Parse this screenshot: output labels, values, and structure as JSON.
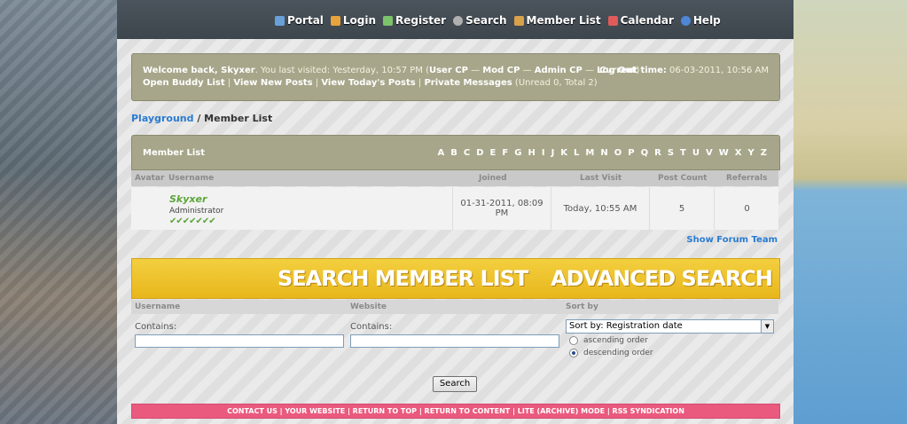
{
  "nav": {
    "items": [
      {
        "label": "Portal",
        "icon": "portal-icon",
        "color": "#6aa0d8"
      },
      {
        "label": "Login",
        "icon": "login-icon",
        "color": "#e8a33c"
      },
      {
        "label": "Register",
        "icon": "register-icon",
        "color": "#7cc36a"
      },
      {
        "label": "Search",
        "icon": "search-icon",
        "color": "#b0b0b0"
      },
      {
        "label": "Member List",
        "icon": "member-list-icon",
        "color": "#d9a14a"
      },
      {
        "label": "Calendar",
        "icon": "calendar-icon",
        "color": "#e05a5a"
      },
      {
        "label": "Help",
        "icon": "help-icon",
        "color": "#4f86d6"
      }
    ]
  },
  "welcome": {
    "prefix": "Welcome back, ",
    "username": "Skyxer",
    "last_visit": ". You last visited: Yesterday, 10:57 PM (",
    "user_cp": "User CP",
    "mod_cp": "Mod CP",
    "admin_cp": "Admin CP",
    "logout": "Log Out",
    "sep": " — ",
    "close": ")",
    "current_time_label": "Current time:",
    "current_time": " 06-03-2011, 10:56 AM",
    "buddy": "Open Buddy List",
    "new_posts": "View New Posts",
    "todays_posts": "View Today's Posts",
    "pms": "Private Messages",
    "pm_counts": " (Unread 0, Total 2)",
    "pipe": " | "
  },
  "breadcrumb": {
    "root": "Playground",
    "sep": " / ",
    "current": "Member List"
  },
  "member_list": {
    "title": "Member List",
    "letters": [
      "A",
      "B",
      "C",
      "D",
      "E",
      "F",
      "G",
      "H",
      "I",
      "J",
      "K",
      "L",
      "M",
      "N",
      "O",
      "P",
      "Q",
      "R",
      "S",
      "T",
      "U",
      "V",
      "W",
      "X",
      "Y",
      "Z"
    ],
    "columns": {
      "avatar": "Avatar",
      "username": "Username",
      "joined": "Joined",
      "last_visit": "Last Visit",
      "post_count": "Post Count",
      "referrals": "Referrals"
    },
    "rows": [
      {
        "username": "Skyxer",
        "role": "Administrator",
        "stars": "✔✔✔✔✔✔✔",
        "joined": "01-31-2011, 08:09 PM",
        "last_visit": "Today, 10:55 AM",
        "post_count": "5",
        "referrals": "0"
      }
    ],
    "show_team": "Show Forum Team"
  },
  "banner": {
    "left": "SEARCH MEMBER LIST",
    "right": "ADVANCED SEARCH"
  },
  "search": {
    "username_label": "Username",
    "website_label": "Website",
    "sortby_label": "Sort by",
    "contains": "Contains:",
    "username_value": "",
    "website_value": "",
    "sort_selected": "Sort by: Registration date",
    "ascending": "ascending order",
    "descending": "descending order",
    "order_selected": "descending",
    "button": "Search"
  },
  "footer": {
    "links": [
      "CONTACT US",
      "YOUR WEBSITE",
      "RETURN TO TOP",
      "RETURN TO CONTENT",
      "LITE (ARCHIVE) MODE",
      "RSS SYNDICATION"
    ],
    "sep": " | "
  }
}
